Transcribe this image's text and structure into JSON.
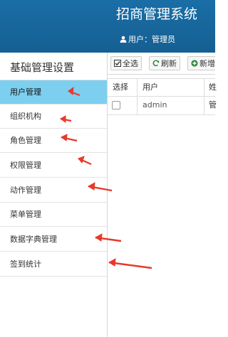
{
  "header": {
    "app_title": "招商管理系统",
    "user_label": "用户：管理员",
    "user_icon": "user-icon",
    "bg_color": "#1a6ea6"
  },
  "sidebar": {
    "title": "基础管理设置",
    "active_color": "#7dcff0",
    "items": [
      {
        "label": "用户管理",
        "active": true
      },
      {
        "label": "组织机构",
        "active": false
      },
      {
        "label": "角色管理",
        "active": false
      },
      {
        "label": "权限管理",
        "active": false
      },
      {
        "label": "动作管理",
        "active": false
      },
      {
        "label": "菜单管理",
        "active": false
      },
      {
        "label": "数据字典管理",
        "active": false
      },
      {
        "label": "签到统计",
        "active": false
      }
    ]
  },
  "toolbar": {
    "select_all_label": "全选",
    "select_all_icon": "checkbox-icon",
    "refresh_label": "刷新",
    "refresh_icon": "refresh-icon",
    "add_label": "新增",
    "add_icon": "plus-circle-icon"
  },
  "grid": {
    "columns": [
      "选择",
      "用户",
      "姓"
    ],
    "rows": [
      {
        "checked": false,
        "user": "admin",
        "name": "管"
      }
    ]
  },
  "annotation": {
    "arrow_color": "#e8392a"
  }
}
